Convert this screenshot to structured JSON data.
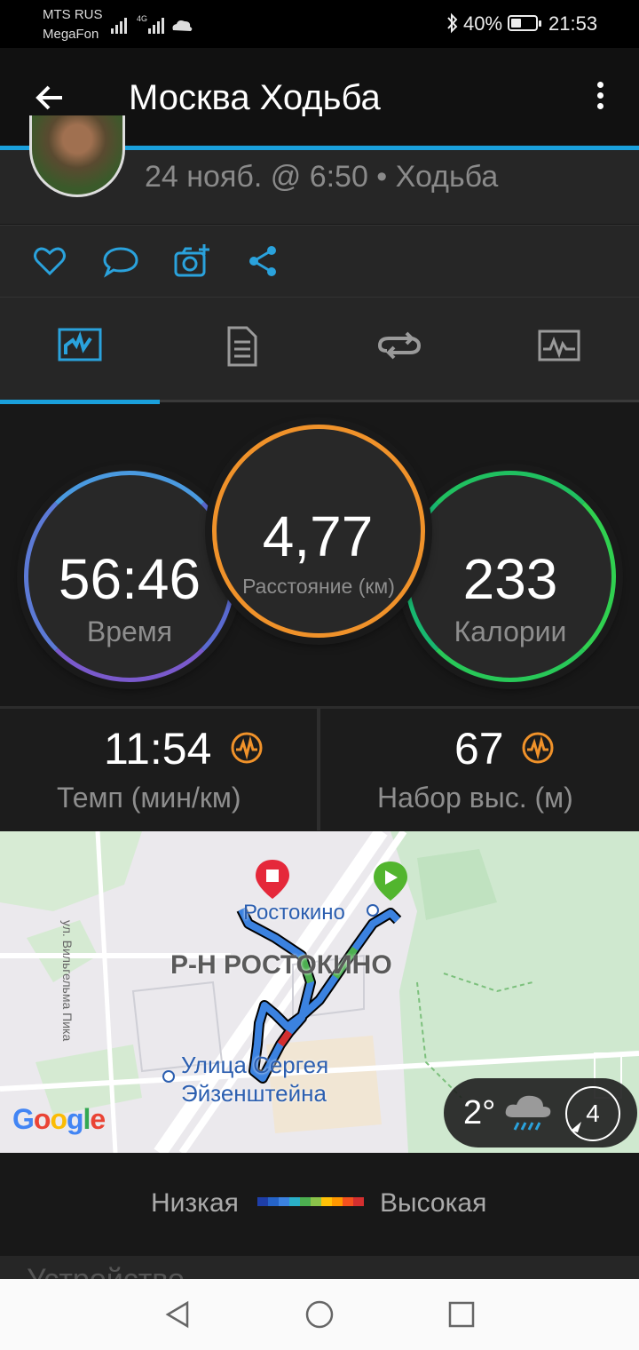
{
  "status_bar": {
    "carrier1": "MTS RUS",
    "carrier2": "MegaFon",
    "network": "4G",
    "battery": "40%",
    "time": "21:53",
    "bluetooth_icon": "bluetooth-icon"
  },
  "app_bar": {
    "title": "Москва Ходьба",
    "back_icon": "arrow-back-icon",
    "menu_icon": "more-vert-icon"
  },
  "activity": {
    "subtitle": "24 нояб. @ 6:50 • Ходьба"
  },
  "actions": [
    "heart-icon",
    "comment-icon",
    "add-photo-icon",
    "share-icon"
  ],
  "tabs": [
    "stats-tab",
    "details-tab",
    "laps-tab",
    "charts-tab"
  ],
  "stats": {
    "time": {
      "value": "56:46",
      "label": "Время"
    },
    "distance": {
      "value": "4,77",
      "label": "Расстояние (км)"
    },
    "calories": {
      "value": "233",
      "label": "Калории"
    }
  },
  "secondary": {
    "pace": {
      "value": "11:54",
      "label": "Темп (мин/км)"
    },
    "elevation": {
      "value": "67",
      "label": "Набор выс. (м)"
    }
  },
  "map": {
    "street_label": "ул. Вильгельма Пика",
    "station1": "Ростокино",
    "district": "Р-Н РОСТОКИНО",
    "station2_line1": "Улица Сергея",
    "station2_line2": "Эйзенштейна",
    "google": "Google",
    "weather_temp": "2°",
    "wind": "4"
  },
  "legend": {
    "low": "Низкая",
    "high": "Высокая",
    "colors": [
      "#1e3ea8",
      "#2563c8",
      "#3b82e0",
      "#2ab0c8",
      "#4caf50",
      "#8bc34a",
      "#ffc107",
      "#ff9800",
      "#f4511e",
      "#d32f2f"
    ]
  },
  "device_section": "Устройство",
  "colors": {
    "accent": "#1aa0dc",
    "time_ring": "#4a9ae0",
    "distance_ring": "#f0922a",
    "calories_ring": "#22c55e"
  }
}
